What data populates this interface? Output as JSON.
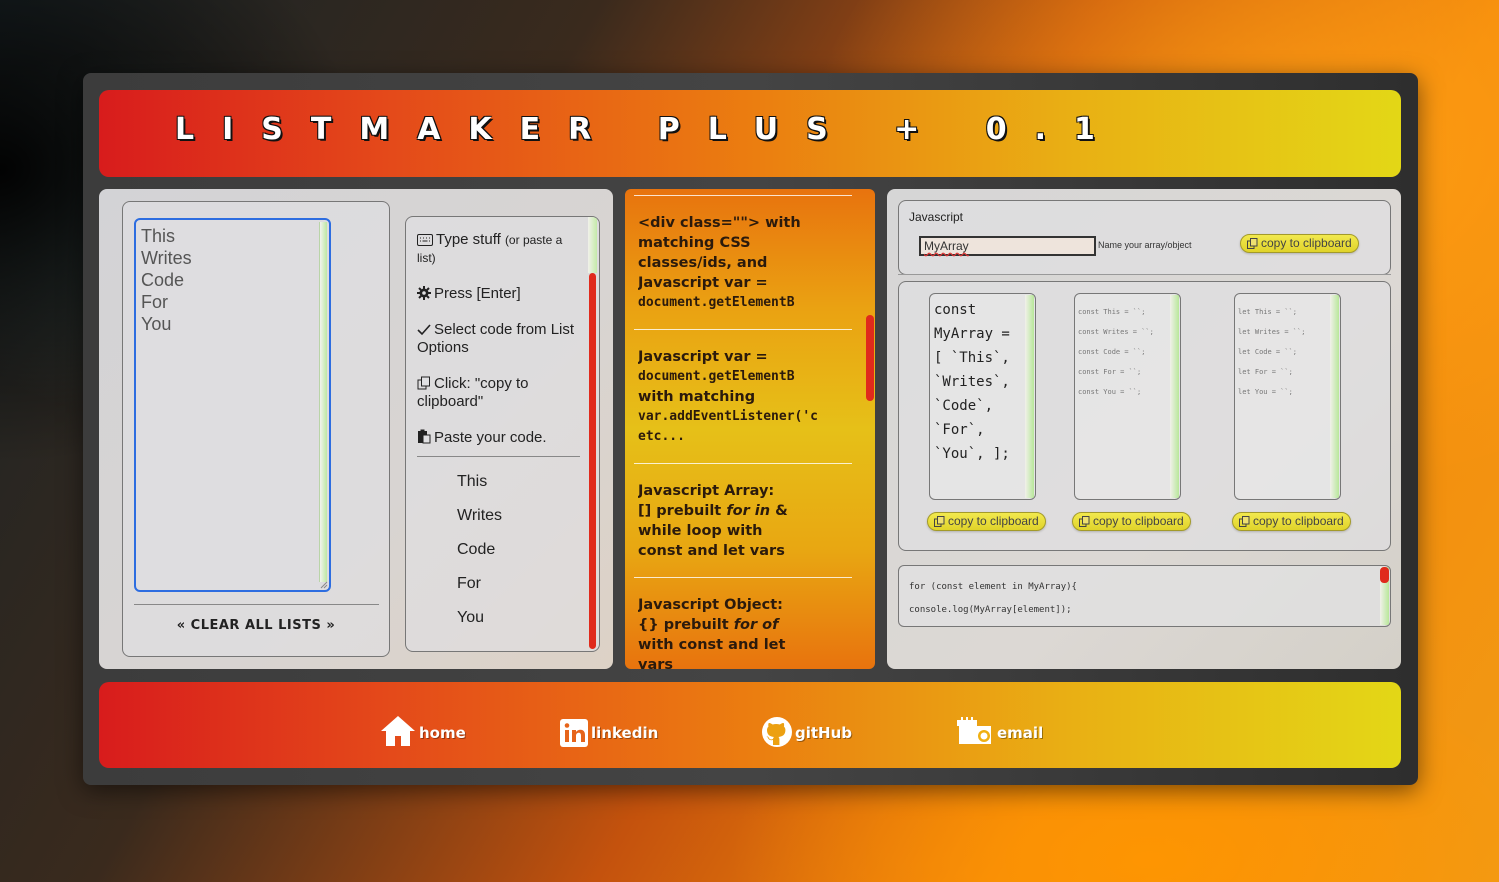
{
  "header": {
    "title": "LISTMAKER PLUS + 0.1"
  },
  "list_input": {
    "lines": [
      "This",
      "Writes",
      "Code",
      "For",
      "You"
    ]
  },
  "clear_button": "« CLEAR ALL LISTS »",
  "instructions": [
    {
      "icon": "keyboard-icon",
      "text": "Type stuff",
      "small": "(or paste a list)"
    },
    {
      "icon": "gear-icon",
      "text": "Press [Enter]"
    },
    {
      "icon": "check-icon",
      "text": "Select code from List Options"
    },
    {
      "icon": "copy-icon",
      "text": "Click: \"copy to clipboard\""
    },
    {
      "icon": "paste-icon",
      "text": "Paste your code."
    }
  ],
  "list_preview": [
    "This",
    "Writes",
    "Code",
    "For",
    "You"
  ],
  "options": [
    {
      "line1": "<div class=\"\"> with",
      "line2": "matching CSS",
      "line3": "classes/ids, and",
      "line4": "Javascript var =",
      "line5": "document.getElementB"
    },
    {
      "line1": "Javascript var =",
      "line2": "document.getElementB",
      "line3": "with matching",
      "line4": "var.addEventListener('c",
      "line5": "etc..."
    },
    {
      "line1": "Javascript Array:",
      "line2": "[] prebuilt",
      "line2b": "for in",
      "line2c": " &",
      "line3": "while loop with",
      "line4": "const and let vars"
    },
    {
      "line1": "Javascript Object:",
      "line2": "{} prebuilt",
      "line2b": "for of",
      "line3": "with const and let",
      "line4": "vars"
    }
  ],
  "js_panel": {
    "label": "Javascript",
    "name_input_value": "MyArray",
    "name_hint": "Name your array/object",
    "copy_label": "copy to clipboard",
    "code1": [
      "const",
      "MyArray =",
      "[ `This`,",
      "`Writes`,",
      "`Code`,",
      "`For`,",
      "`You`, ];"
    ],
    "code2": [
      "const This = ``;",
      "const Writes = ``;",
      "const Code = ``;",
      "const For = ``;",
      "const You = ``;"
    ],
    "code3": [
      "let This = ``;",
      "let Writes = ``;",
      "let Code = ``;",
      "let For = ``;",
      "let You = ``;"
    ],
    "loop_code": [
      "for (const element in MyArray){",
      "console.log(MyArray[element]);"
    ]
  },
  "footer": {
    "home": "home",
    "linkedin": "linkedin",
    "github": "gitHub",
    "email": "email"
  },
  "colors": {
    "accent_red": "#d81c1c",
    "accent_yellow": "#e3d716",
    "scroll_red": "#e02a1c",
    "focus_blue": "#2d6de0"
  }
}
